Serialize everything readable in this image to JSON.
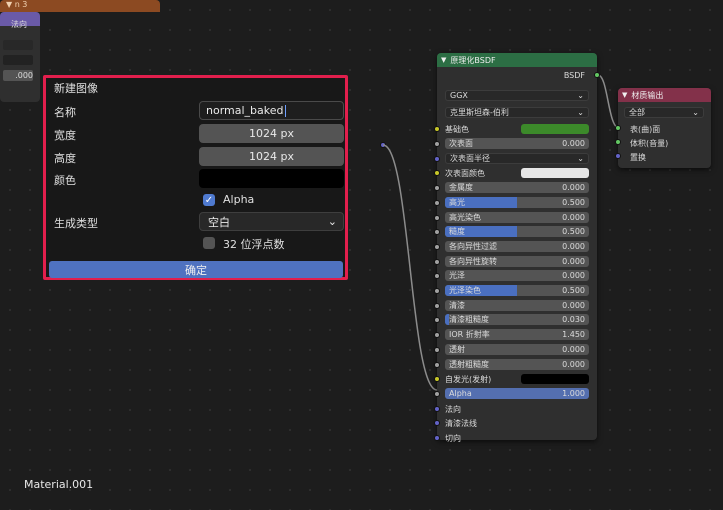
{
  "bg_nodes": {
    "orange_title": "▼ n 3",
    "purple_socket_label": "法向",
    "purple_value": ".000"
  },
  "dialog": {
    "title": "新建图像",
    "name_label": "名称",
    "name_value": "normal_baked",
    "width_label": "宽度",
    "width_value": "1024 px",
    "height_label": "高度",
    "height_value": "1024 px",
    "color_label": "颜色",
    "color_value": "#000000",
    "alpha_label": "Alpha",
    "alpha_checked": true,
    "gen_type_label": "生成类型",
    "gen_type_value": "空白",
    "float_label": "32 位浮点数",
    "float_checked": false,
    "ok_label": "确定"
  },
  "bsdf": {
    "title": "原理化BSDF",
    "output_label": "BSDF",
    "distribution": "GGX",
    "subsurface_method": "克里斯坦森-伯利",
    "base_color_label": "基础色",
    "base_color": "#3c8a2a",
    "subsurface_color": "#e6e6e6",
    "emission_color": "#000000",
    "inputs": [
      {
        "label": "次表面",
        "value": "0.000",
        "fill": 0,
        "type": "field",
        "socket": "gray"
      },
      {
        "label": "次表面半径",
        "value": "",
        "fill": 0,
        "type": "dropdown",
        "socket": "blue"
      },
      {
        "label": "次表面颜色",
        "value": "",
        "fill": 0,
        "type": "color",
        "socket": "yellow"
      },
      {
        "label": "金属度",
        "value": "0.000",
        "fill": 0,
        "type": "field",
        "socket": "gray"
      },
      {
        "label": "高光",
        "value": "0.500",
        "fill": 0.5,
        "type": "field",
        "socket": "gray"
      },
      {
        "label": "高光染色",
        "value": "0.000",
        "fill": 0,
        "type": "field",
        "socket": "gray"
      },
      {
        "label": "糙度",
        "value": "0.500",
        "fill": 0.5,
        "type": "field",
        "socket": "gray"
      },
      {
        "label": "各向异性过滤",
        "value": "0.000",
        "fill": 0,
        "type": "field",
        "socket": "gray"
      },
      {
        "label": "各向异性旋转",
        "value": "0.000",
        "fill": 0,
        "type": "field",
        "socket": "gray"
      },
      {
        "label": "光泽",
        "value": "0.000",
        "fill": 0,
        "type": "field",
        "socket": "gray"
      },
      {
        "label": "光泽染色",
        "value": "0.500",
        "fill": 0.5,
        "type": "field",
        "socket": "gray"
      },
      {
        "label": "清漆",
        "value": "0.000",
        "fill": 0,
        "type": "field",
        "socket": "gray"
      },
      {
        "label": "清漆粗糙度",
        "value": "0.030",
        "fill": 0.03,
        "type": "field",
        "socket": "gray"
      },
      {
        "label": "IOR 折射率",
        "value": "1.450",
        "fill": 0,
        "type": "field",
        "socket": "gray"
      },
      {
        "label": "透射",
        "value": "0.000",
        "fill": 0,
        "type": "field",
        "socket": "gray"
      },
      {
        "label": "透射粗糙度",
        "value": "0.000",
        "fill": 0,
        "type": "field",
        "socket": "gray"
      },
      {
        "label": "自发光(发射)",
        "value": "",
        "fill": 0,
        "type": "color",
        "socket": "yellow"
      },
      {
        "label": "Alpha",
        "value": "1.000",
        "fill": 1,
        "type": "field",
        "socket": "gray"
      },
      {
        "label": "法向",
        "value": "",
        "fill": 0,
        "type": "socket",
        "socket": "blue"
      },
      {
        "label": "清漆法线",
        "value": "",
        "fill": 0,
        "type": "socket",
        "socket": "blue"
      },
      {
        "label": "切向",
        "value": "",
        "fill": 0,
        "type": "socket",
        "socket": "blue"
      }
    ]
  },
  "matout": {
    "title": "材质输出",
    "target": "全部",
    "inputs": [
      "表(曲)面",
      "体积(音量)",
      "置换"
    ]
  },
  "material_name": "Material.001"
}
